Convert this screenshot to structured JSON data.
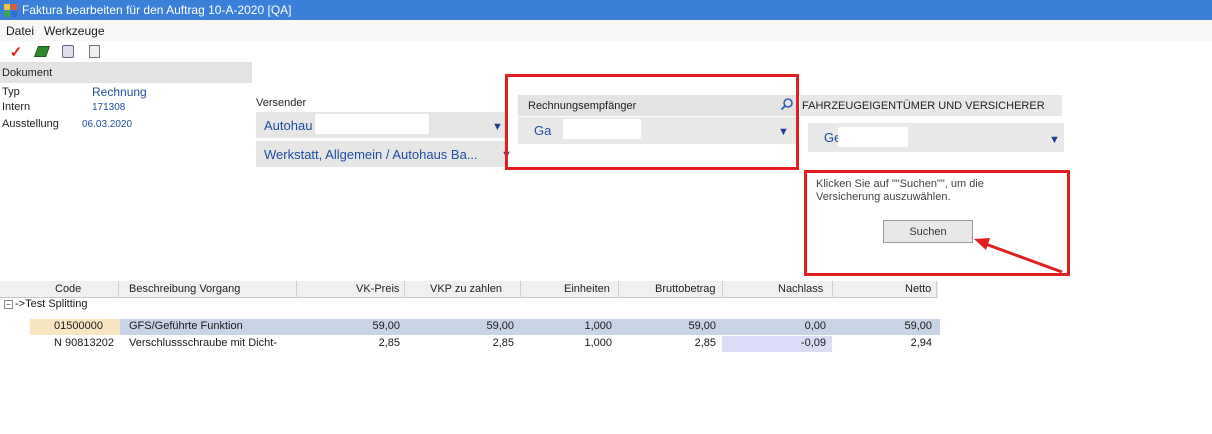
{
  "window": {
    "title": "Faktura bearbeiten für den Auftrag 10-A-2020 [QA]"
  },
  "menu": {
    "items": [
      "Datei",
      "Werkzeuge"
    ]
  },
  "toolbar": {
    "icons": [
      "check-icon",
      "book-icon",
      "document-icon",
      "calculator-icon"
    ]
  },
  "dokument": {
    "header": "Dokument",
    "rows": [
      {
        "label": "Typ",
        "value": "Rechnung"
      },
      {
        "label": "Intern",
        "value": "171308"
      },
      {
        "label": "Ausstellung",
        "value": "06.03.2020"
      }
    ]
  },
  "versender": {
    "header": "Versender",
    "field1": "Autohau",
    "field2": "Werkstatt,  Allgemein / Autohaus Ba..."
  },
  "rechnungsempfaenger": {
    "header": "Rechnungsempfänger",
    "field": "Ga"
  },
  "fahrzeug": {
    "header": "FAHRZEUGEIGENTÜMER UND VERSICHERER",
    "field": "Ge",
    "note": "Klicken Sie auf \"\"Suchen\"\", um die Versicherung auszuwählen.",
    "search_button": "Suchen"
  },
  "grid": {
    "columns": [
      "Code",
      "Beschreibung Vorgang",
      "VK-Preis",
      "VKP zu zahlen",
      "Einheiten",
      "Bruttobetrag",
      "Nachlass",
      "Netto"
    ],
    "group": "->Test Splitting",
    "rows": [
      {
        "code": "01500000",
        "desc": "GFS/Geführte Funktion",
        "vk": "59,00",
        "vkp": "59,00",
        "einheiten": "1,000",
        "brutto": "59,00",
        "nachlass": "0,00",
        "netto": "59,00"
      },
      {
        "code": "N  90813202",
        "desc": "Verschlussschraube mit Dicht-",
        "vk": "2,85",
        "vkp": "2,85",
        "einheiten": "1,000",
        "brutto": "2,85",
        "nachlass": "-0,09",
        "netto": "2,94"
      }
    ]
  },
  "colors": {
    "title_bar": "#3a7fd8",
    "highlight": "#e02020",
    "value_text": "#1f4fa0"
  }
}
